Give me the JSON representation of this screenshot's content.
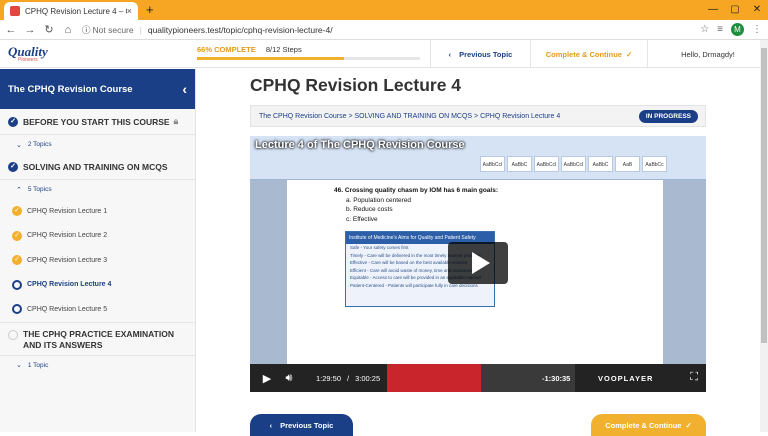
{
  "browser": {
    "tab_title": "CPHQ Revision Lecture 4 – Quali",
    "tab_close": "×",
    "new_tab": "+",
    "not_secure": "Not secure",
    "url": "qualitypioneers.test/topic/cphq-revision-lecture-4/",
    "profile_initial": "M"
  },
  "logo": {
    "line1": "Quality",
    "line2": "Pioneers"
  },
  "topbar": {
    "progress_pct": "66% COMPLETE",
    "progress_steps": "8/12 Steps",
    "progress_value": 0.66,
    "prev_label": "Previous Topic",
    "complete_label": "Complete & Continue",
    "greeting": "Hello, Drmagdy!"
  },
  "sidebar": {
    "course_title": "The CPHQ Revision Course",
    "sections": [
      {
        "title": "BEFORE YOU START THIS COURSE",
        "topics": "2 Topics"
      },
      {
        "title": "SOLVING AND TRAINING ON MCQS",
        "topics": "5 Topics"
      },
      {
        "title": "THE CPHQ PRACTICE EXAMINATION AND ITS ANSWERS",
        "topics": "1 Topic"
      }
    ],
    "lessons": [
      "CPHQ Revision Lecture 1",
      "CPHQ Revision Lecture 2",
      "CPHQ Revision Lecture 3",
      "CPHQ Revision Lecture 4",
      "CPHQ Revision Lecture 5"
    ]
  },
  "main": {
    "title": "CPHQ Revision Lecture 4",
    "breadcrumb": "The CPHQ Revision Course > SOLVING AND TRAINING ON MCQS > CPHQ Revision Lecture 4",
    "status": "IN PROGRESS",
    "bottom_prev": "Previous Topic",
    "bottom_next": "Complete & Continue"
  },
  "video": {
    "title": "Lecture 4 of The CPHQ Revision Course",
    "question": "46. Crossing quality chasm by IOM has 6 main goals:",
    "answers": [
      "a. Population centered",
      "b. Reduce costs",
      "c. Effective"
    ],
    "slide_header": "Institute of Medicine's Aims for Quality and Patient Safety",
    "slide_rows": [
      "Safe - Your safety comes first",
      "Timely - Care will be delivered in the most timely manner possible",
      "Effective - Care will be based on the best available science",
      "Efficient - Care will avoid waste of money, time and resources",
      "Equitable - Access to care will be provided in an equitable manner",
      "Patient-Centered - Patients will participate fully in care decisions"
    ],
    "ribbon_styles": [
      "AaBbCcI",
      "AaBbC",
      "AaBbCcI",
      "AaBbCcI",
      "AaBbC",
      "AaB",
      "AaBbCc"
    ],
    "current_time": "1:29:50",
    "separator": "/",
    "duration": "3:00:25",
    "remaining": "-1:30:35",
    "played_fraction": 0.498,
    "brand": "VOOPLAYER"
  }
}
